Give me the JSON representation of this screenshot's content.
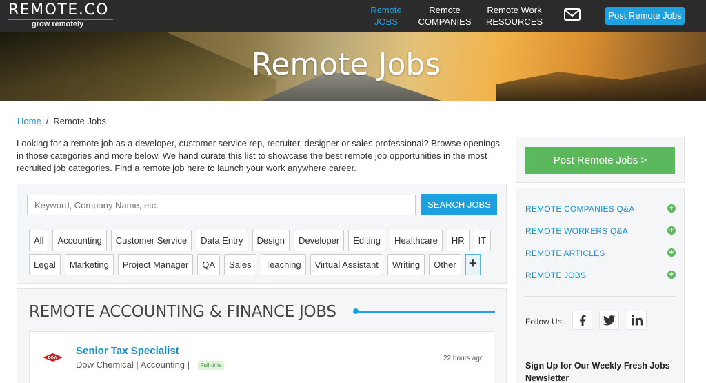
{
  "nav": {
    "logo_text": "REMOTE.CO",
    "tagline": "grow remotely",
    "items": [
      {
        "line1": "Remote",
        "line2": "JOBS"
      },
      {
        "line1": "Remote",
        "line2": "COMPANIES"
      },
      {
        "line1": "Remote Work",
        "line2": "RESOURCES"
      }
    ],
    "post_button": "Post Remote Jobs",
    "accent": "#1da1e0"
  },
  "hero": {
    "title": "Remote Jobs"
  },
  "breadcrumb": {
    "home": "Home",
    "sep": "/",
    "current": "Remote Jobs"
  },
  "intro": "Looking for a remote job as a developer, customer service rep, recruiter, designer or sales professional? Browse openings in those categories and more below. We hand curate this list to showcase the best remote job opportunities in the most recruited job categories. Find a remote job here to launch your work anywhere career.",
  "search": {
    "placeholder": "Keyword, Company Name, etc.",
    "button": "SEARCH JOBS"
  },
  "categories": {
    "row1": [
      "All",
      "Accounting",
      "Customer Service",
      "Data Entry",
      "Design",
      "Developer",
      "Editing",
      "Healthcare",
      "HR",
      "IT"
    ],
    "row2": [
      "Legal",
      "Marketing",
      "Project Manager",
      "QA",
      "Sales",
      "Teaching",
      "Virtual Assistant",
      "Writing",
      "Other"
    ],
    "more": "+"
  },
  "section": {
    "title": "REMOTE ACCOUNTING & FINANCE JOBS",
    "job": {
      "logo_text": "DOW",
      "title": "Senior Tax Specialist",
      "company": "Dow Chemical",
      "category": "Accounting",
      "badge": "Full-time",
      "time": "22 hours ago"
    }
  },
  "sidebar": {
    "post_button": "Post Remote Jobs >",
    "links": [
      "REMOTE COMPANIES Q&A",
      "REMOTE WORKERS Q&A",
      "REMOTE ARTICLES",
      "REMOTE JOBS"
    ],
    "follow_label": "Follow Us:",
    "social": [
      "facebook-icon",
      "twitter-icon",
      "linkedin-icon"
    ],
    "newsletter": "Sign Up for Our Weekly Fresh Jobs Newsletter",
    "green": "#5cb85c"
  }
}
